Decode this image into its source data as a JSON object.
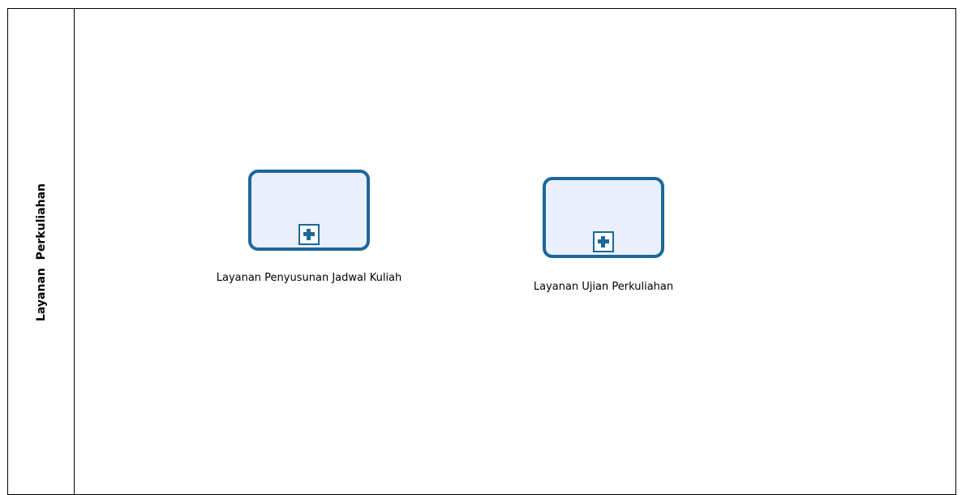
{
  "lane": {
    "label": "Layanan  Perkuliahan"
  },
  "tasks": [
    {
      "label": "Layanan Penyusunan Jadwal Kuliah",
      "type": "collapsed-subprocess",
      "marker_icon": "plus-square-icon"
    },
    {
      "label": "Layanan Ujian Perkuliahan",
      "type": "collapsed-subprocess",
      "marker_icon": "plus-square-icon"
    }
  ],
  "colors": {
    "task_border": "#1d6799",
    "task_fill": "#eaf0fb",
    "pool_border": "#000000"
  }
}
